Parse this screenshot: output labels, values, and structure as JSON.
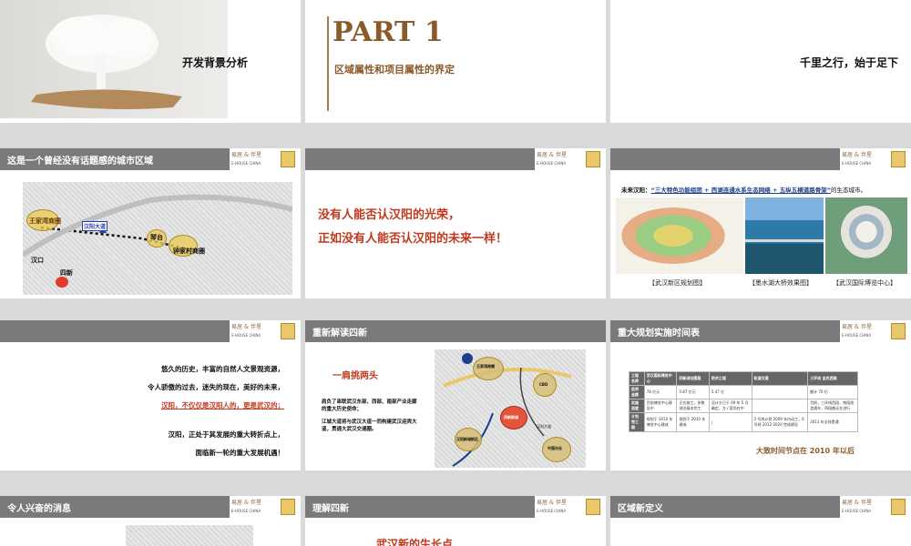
{
  "slides": [
    {
      "id": 1,
      "title": "开发背景分析"
    },
    {
      "id": 2,
      "part": "PART 1",
      "subtitle": "区域属性和项目属性的界定"
    },
    {
      "id": 3,
      "text": "千里之行，始于足下"
    },
    {
      "id": 4,
      "bar_title": "这是一个曾经没有话题感的城市区域",
      "labels": [
        "王家湾商圈",
        "汉阳大道",
        "琴台",
        "钟家村商圈",
        "汉口",
        "四新"
      ]
    },
    {
      "id": 5,
      "bar_title": "",
      "line1": "没有人能否认汉阳的光荣，",
      "line2": "正如没有人能否认汉阳的未来一样！"
    },
    {
      "id": 6,
      "bar_title": "",
      "caption_prefix": "未来汉阳：",
      "caption_quote": "“三大特色功能组团 + 西湖连通水系生态网络 + 五纵五横道路骨架”",
      "caption_suffix": "的生态城市。",
      "photo_captions": [
        "【武汉新区规划图】",
        "【墨水湖大桥效果图】",
        "【武汉国际博览中心】"
      ]
    },
    {
      "id": 7,
      "bar_title": "",
      "lines": [
        "悠久的历史，丰富的自然人文景观资源，",
        "令人骄傲的过去，迷失的现在，美好的未来，",
        "汉阳，不仅仅是汉阳人的，更是武汉的；",
        "汉阳，正处于其发展的重大转折点上，",
        "面临新一轮的重大发展机遇！"
      ]
    },
    {
      "id": 8,
      "bar_title": "重新解读四新",
      "heading": "一肩挑两头",
      "para1": "肩负了串联武汉东部、西部、南部产业走廊的重大历史使命；",
      "para2": "江城大道将与武汉大道一同构建武汉迎宾大道，贯通大武汉交通圈。",
      "map_labels": [
        "王家湾商圈",
        "CBD",
        "四新新城",
        "汉阳新城新区",
        "中国光谷",
        "汉阳大道"
      ]
    },
    {
      "id": 9,
      "bar_title": "重大规划实施时间表",
      "footer": "大致时间节点在 2010 年以后",
      "table": {
        "rows": [
          [
            "工程名称",
            "武汉国际博览中心",
            "四新湖泊围垦",
            "防洪工程",
            "轨道交通",
            "三环线 金色西路"
          ],
          [
            "投资金额",
            "78 亿元",
            "5.87 亿元",
            "5.47 亿",
            "",
            "额计 70 亿"
          ],
          [
            "实施进度",
            "目前博览中心建设中",
            "正在施工，多数湖泊基本完工",
            "设计方已于 09 年 5 月确定，方 / 案尚在中",
            "",
            "目前，三环线西段、南段改造通车，四段搬迁在进行"
          ],
          [
            "计划完工期",
            "规划于 2010 年博览中心建成",
            "规划于 2010 年建成",
            "/",
            "3 号线计划 2009 年内动工，6 号线 2012-2020 完成建设",
            "2011 年全线贯通"
          ]
        ]
      }
    },
    {
      "id": 10,
      "bar_title": "令人兴奋的消息"
    },
    {
      "id": 11,
      "bar_title": "理解四新",
      "text": "武汉新的生长点"
    },
    {
      "id": 12,
      "bar_title": "区域新定义"
    }
  ],
  "logo": {
    "cn": "易居 & 伴星",
    "en": "E-HOUSE CHINA"
  }
}
